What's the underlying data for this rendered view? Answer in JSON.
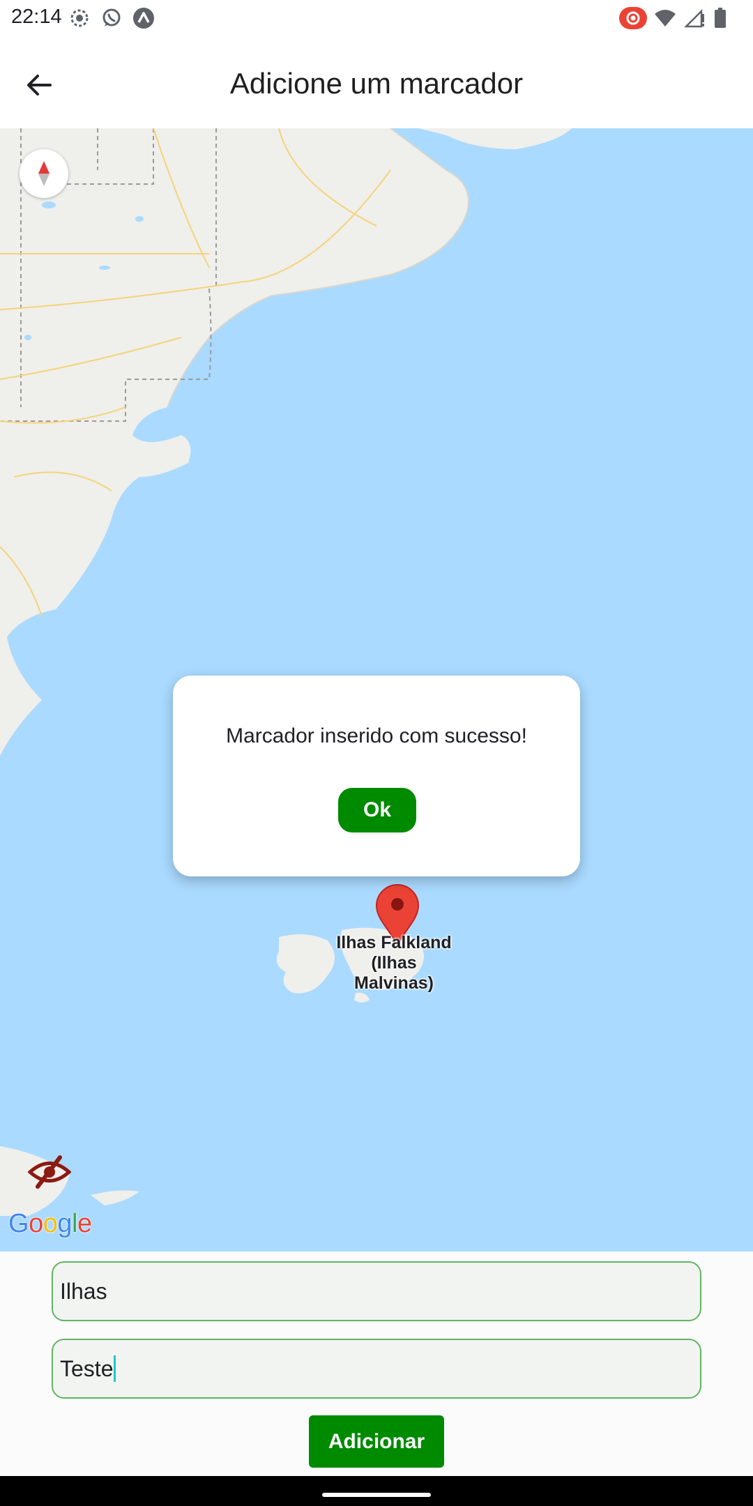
{
  "status_bar": {
    "time": "22:14",
    "left_icons": [
      "screen-record-icon",
      "whatsapp-icon",
      "arc-app-icon"
    ],
    "right_icons": [
      "cast-record-icon",
      "wifi-icon",
      "signal-icon",
      "battery-icon"
    ]
  },
  "app_bar": {
    "title": "Adicione um marcador",
    "back_icon": "arrow-back-icon"
  },
  "map": {
    "place_label_line1": "Ilhas Falkland",
    "place_label_line2": "(Ilhas",
    "place_label_line3": "Malvinas)",
    "attribution": "Google",
    "colors": {
      "water": "#aadaff",
      "land": "#efefeb",
      "pin": "#ea4335"
    }
  },
  "dialog": {
    "message": "Marcador inserido com sucesso!",
    "ok_label": "Ok"
  },
  "form": {
    "title_value": "Ilhas",
    "description_value": "Teste",
    "submit_label": "Adicionar",
    "accent_color": "#008a00"
  }
}
